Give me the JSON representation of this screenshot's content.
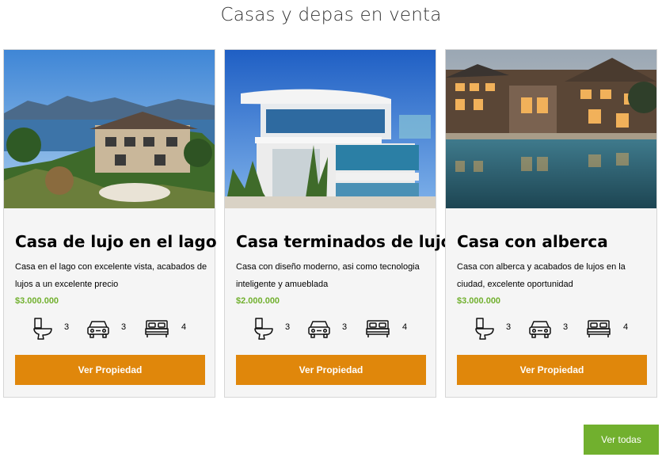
{
  "page": {
    "title": "Casas y depas en venta"
  },
  "properties": [
    {
      "title": "Casa de lujo en el lago",
      "description": "Casa en el lago con excelente vista, acabados de lujos a un excelente precio",
      "price": "$3.000.000",
      "bathrooms": "3",
      "parking": "3",
      "bedrooms": "4",
      "button_label": "Ver Propiedad"
    },
    {
      "title": "Casa terminados de lujo",
      "description": "Casa con diseño moderno, asi como tecnologia inteligente y amueblada",
      "price": "$2.000.000",
      "bathrooms": "3",
      "parking": "3",
      "bedrooms": "4",
      "button_label": "Ver Propiedad"
    },
    {
      "title": "Casa con alberca",
      "description": "Casa con alberca y acabados de lujos en la ciudad, excelente oportunidad",
      "price": "$3.000.000",
      "bathrooms": "3",
      "parking": "3",
      "bedrooms": "4",
      "button_label": "Ver Propiedad"
    }
  ],
  "footer": {
    "view_all_label": "Ver todas"
  },
  "colors": {
    "accent_orange": "#e0870b",
    "accent_green": "#71b02e",
    "card_bg": "#f5f5f5"
  },
  "icons": {
    "bathroom": "toilet-icon",
    "parking": "car-icon",
    "bedroom": "bed-icon"
  }
}
